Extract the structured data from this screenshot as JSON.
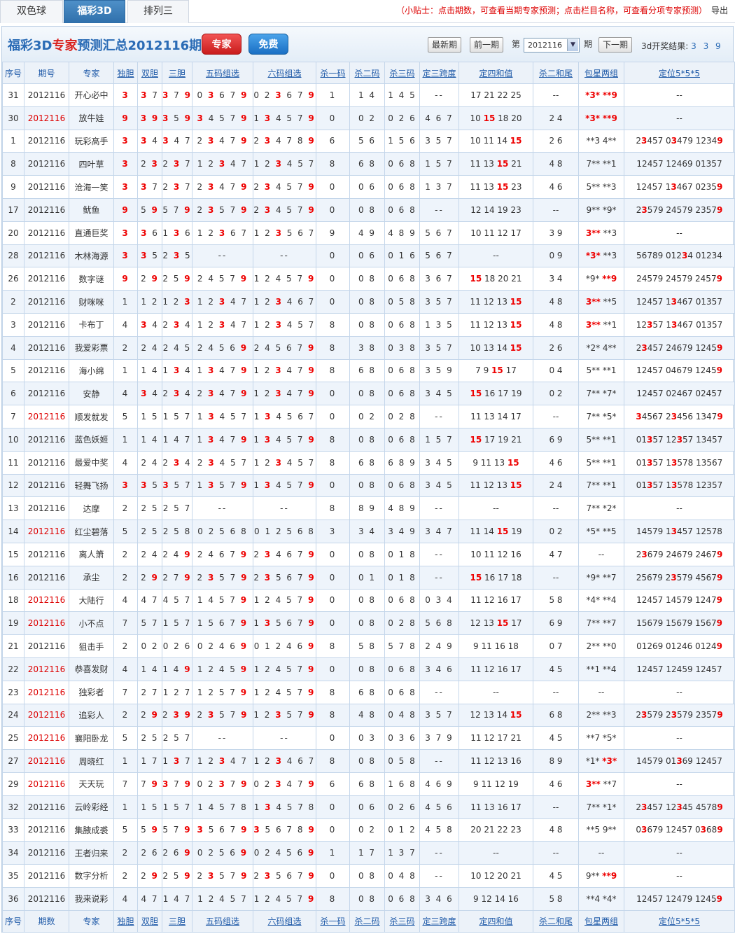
{
  "tabs": [
    "双色球",
    "福彩3D",
    "排列三"
  ],
  "active_tab": 1,
  "tip": "（小贴士：点击期数，可查看当期专家预测；点击栏目名称，可查看分项专家预测）",
  "export_label": "导出",
  "header": {
    "title_a": "福彩3D",
    "title_b": "专家",
    "title_c": "预测汇总2012116期",
    "btn_expert": "专家",
    "btn_free": "免费",
    "btn_latest": "最新期",
    "btn_prev": "前一期",
    "label_di": "第",
    "period_value": "2012116",
    "label_qi": "期",
    "btn_next": "下一期",
    "result_label": "3d开奖结果:",
    "result_value": "3 3 9"
  },
  "columns": [
    "序号",
    "期号",
    "专家",
    "独胆",
    "双胆",
    "三胆",
    "五码组选",
    "六码组选",
    "杀一码",
    "杀二码",
    "杀三码",
    "定三跨度",
    "定四和值",
    "杀二和尾",
    "包星两组",
    "定位5*5*5"
  ],
  "footer_columns": [
    "序号",
    "期数",
    "专家",
    "独胆",
    "双胆",
    "三胆",
    "五码组选",
    "六码组选",
    "杀一码",
    "杀二码",
    "杀三码",
    "定三跨度",
    "定四和值",
    "杀二和尾",
    "包星两组",
    "定位5*5*5"
  ],
  "colors": {
    "hit": "#e00000",
    "link": "#1f5aa8",
    "border": "#c4d6ea"
  },
  "rows": [
    [
      "31",
      "2012116",
      "开心必中",
      "[3]",
      "[3] 7",
      "[3] 7 [9]",
      "0 [3] 6 7 [9]",
      "0 2 [3] 6 7 [9]",
      "1",
      "1 4",
      "1 4 5",
      "--",
      "17 21 22 25",
      "--",
      "[*3*] [**9]",
      "--"
    ],
    [
      "30",
      "2012116",
      "放牛娃",
      "[9]",
      "[3] [9]",
      "[3] 5 [9]",
      "[3] 4 5 7 [9]",
      "1 [3] 4 5 7 [9]",
      "0",
      "0 2",
      "0 2 6",
      "4 6 7",
      "10 [15] 18 20",
      "2 4",
      "[*3*] [**9]",
      "--"
    ],
    [
      "1",
      "2012116",
      "玩彩高手",
      "[3]",
      "[3] 4",
      "[3] 4 7",
      "2 [3] 4 7 [9]",
      "2 [3] 4 7 8 [9]",
      "6",
      "5 6",
      "1 5 6",
      "3 5 7",
      "10 11 14 [15]",
      "2 6",
      "**3 4**",
      "2[3]457 0[3]479 1234[9]"
    ],
    [
      "8",
      "2012116",
      "四叶草",
      "[3]",
      "2 [3]",
      "2 [3] 7",
      "1 2 [3] 4 7",
      "1 2 [3] 4 5 7",
      "8",
      "6 8",
      "0 6 8",
      "1 5 7",
      "11 13 [15] 21",
      "4 8",
      "7** **1",
      "12457 12469 01357"
    ],
    [
      "9",
      "2012116",
      "沧海一笑",
      "[3]",
      "[3] 7",
      "2 [3] 7",
      "2 [3] 4 7 [9]",
      "2 [3] 4 5 7 [9]",
      "0",
      "0 6",
      "0 6 8",
      "1 3 7",
      "11 13 [15] 23",
      "4 6",
      "5** **3",
      "12457 1[3]467 0235[9]"
    ],
    [
      "17",
      "2012116",
      "鱿鱼",
      "[9]",
      "5 [9]",
      "5 7 [9]",
      "2 [3] 5 7 [9]",
      "2 [3] 4 5 7 [9]",
      "0",
      "0 8",
      "0 6 8",
      "--",
      "12 14 19 23",
      "--",
      "9** *9*",
      "2[3]579 24579 2357[9]"
    ],
    [
      "20",
      "2012116",
      "直通巨奖",
      "[3]",
      "[3] 6",
      "1 [3] 6",
      "1 2 [3] 6 7",
      "1 2 [3] 5 6 7",
      "9",
      "4 9",
      "4 8 9",
      "5 6 7",
      "10 11 12 17",
      "3 9",
      "[3**] **3",
      "--"
    ],
    [
      "28",
      "2012116",
      "木林海源",
      "[3]",
      "[3] 5",
      "2 [3] 5",
      "--",
      "--",
      "0",
      "0 6",
      "0 1 6",
      "5 6 7",
      "--",
      "0 9",
      "[*3*] **3",
      "56789 012[3]4 01234"
    ],
    [
      "26",
      "2012116",
      "数字谜",
      "[9]",
      "2 [9]",
      "2 5 [9]",
      "2 4 5 7 [9]",
      "1 2 4 5 7 [9]",
      "0",
      "0 8",
      "0 6 8",
      "3 6 7",
      "[15] 18 20 21",
      "3 4",
      "*9* [**9]",
      "24579 24579 2457[9]"
    ],
    [
      "2",
      "2012116",
      "财咪咪",
      "1",
      "1 2",
      "1 2 [3]",
      "1 2 [3] 4 7",
      "1 2 [3] 4 6 7",
      "0",
      "0 8",
      "0 5 8",
      "3 5 7",
      "11 12 13 [15]",
      "4 8",
      "[3**] **5",
      "12457 1[3]467 01357"
    ],
    [
      "3",
      "2012116",
      "卡布丁",
      "4",
      "[3] 4",
      "2 [3] 4",
      "1 2 [3] 4 7",
      "1 2 [3] 4 5 7",
      "8",
      "0 8",
      "0 6 8",
      "1 3 5",
      "11 12 13 [15]",
      "4 8",
      "[3**] **1",
      "12[3]57 1[3]467 01357"
    ],
    [
      "4",
      "2012116",
      "我爱彩票",
      "2",
      "2 4",
      "2 4 5",
      "2 4 5 6 [9]",
      "2 4 5 6 7 [9]",
      "8",
      "3 8",
      "0 3 8",
      "3 5 7",
      "10 13 14 [15]",
      "2 6",
      "*2* 4**",
      "2[3]457 24679 1245[9]"
    ],
    [
      "5",
      "2012116",
      "海小绵",
      "1",
      "1 4",
      "1 [3] 4",
      "1 [3] 4 7 [9]",
      "1 2 [3] 4 7 [9]",
      "8",
      "6 8",
      "0 6 8",
      "3 5 9",
      "7 9 [15] 17",
      "0 4",
      "5** **1",
      "12457 04679 1245[9]"
    ],
    [
      "6",
      "2012116",
      "安静",
      "4",
      "[3] 4",
      "2 [3] 4",
      "2 [3] 4 7 [9]",
      "1 2 [3] 4 7 [9]",
      "0",
      "0 8",
      "0 6 8",
      "3 4 5",
      "[15] 16 17 19",
      "0 2",
      "7** *7*",
      "12457 02467 02457"
    ],
    [
      "7",
      "2012116",
      "顺发就发",
      "5",
      "1 5",
      "1 5 7",
      "1 [3] 4 5 7",
      "1 [3] 4 5 6 7",
      "0",
      "0 2",
      "0 2 8",
      "--",
      "11 13 14 17",
      "--",
      "7** *5*",
      "[3]4567 2[3]456 1347[9]"
    ],
    [
      "10",
      "2012116",
      "蓝色妖姬",
      "1",
      "1 4",
      "1 4 7",
      "1 [3] 4 7 [9]",
      "1 [3] 4 5 7 [9]",
      "8",
      "0 8",
      "0 6 8",
      "1 5 7",
      "[15] 17 19 21",
      "6 9",
      "5** **1",
      "01[3]57 12[3]57 13457"
    ],
    [
      "11",
      "2012116",
      "最爱中奖",
      "4",
      "2 4",
      "2 [3] 4",
      "2 [3] 4 5 7",
      "1 2 [3] 4 5 7",
      "8",
      "6 8",
      "6 8 9",
      "3 4 5",
      "9 11 13 [15]",
      "4 6",
      "5** **1",
      "01[3]57 1[3]578 13567"
    ],
    [
      "12",
      "2012116",
      "轻舞飞扬",
      "[3]",
      "[3] 5",
      "[3] 5 7",
      "1 [3] 5 7 [9]",
      "1 [3] 4 5 7 [9]",
      "0",
      "0 8",
      "0 6 8",
      "3 4 5",
      "11 12 13 [15]",
      "2 4",
      "7** **1",
      "01[3]57 1[3]578 12357"
    ],
    [
      "13",
      "2012116",
      "达摩",
      "2",
      "2 5",
      "2 5 7",
      "--",
      "--",
      "8",
      "8 9",
      "4 8 9",
      "--",
      "--",
      "--",
      "7** *2*",
      "--"
    ],
    [
      "14",
      "2012116",
      "红尘碧落",
      "5",
      "2 5",
      "2 5 8",
      "0 2 5 6 8",
      "0 1 2 5 6 8",
      "3",
      "3 4",
      "3 4 9",
      "3 4 7",
      "11 14 [15] 19",
      "0 2",
      "*5* **5",
      "14579 1[3]457 12578"
    ],
    [
      "15",
      "2012116",
      "离人箫",
      "2",
      "2 4",
      "2 4 [9]",
      "2 4 6 7 [9]",
      "2 [3] 4 6 7 [9]",
      "0",
      "0 8",
      "0 1 8",
      "--",
      "10 11 12 16",
      "4 7",
      "--",
      "2[3]679 24679 2467[9]"
    ],
    [
      "16",
      "2012116",
      "承尘",
      "2",
      "2 [9]",
      "2 7 [9]",
      "2 [3] 5 7 [9]",
      "2 [3] 5 6 7 [9]",
      "0",
      "0 1",
      "0 1 8",
      "--",
      "[15] 16 17 18",
      "--",
      "*9* **7",
      "25679 2[3]579 4567[9]"
    ],
    [
      "18",
      "2012116",
      "大陆行",
      "4",
      "4 7",
      "4 5 7",
      "1 4 5 7 [9]",
      "1 2 4 5 7 [9]",
      "0",
      "0 8",
      "0 6 8",
      "0 3 4",
      "11 12 16 17",
      "5 8",
      "*4* **4",
      "12457 14579 1247[9]"
    ],
    [
      "19",
      "2012116",
      "小不点",
      "7",
      "5 7",
      "1 5 7",
      "1 5 6 7 [9]",
      "1 [3] 5 6 7 [9]",
      "0",
      "0 8",
      "0 2 8",
      "5 6 8",
      "12 13 [15] 17",
      "6 9",
      "7** **7",
      "15679 15679 1567[9]"
    ],
    [
      "21",
      "2012116",
      "狙击手",
      "2",
      "0 2",
      "0 2 6",
      "0 2 4 6 [9]",
      "0 1 2 4 6 [9]",
      "8",
      "5 8",
      "5 7 8",
      "2 4 9",
      "9 11 16 18",
      "0 7",
      "2** **0",
      "01269 01246 0124[9]"
    ],
    [
      "22",
      "2012116",
      "恭喜发财",
      "4",
      "1 4",
      "1 4 [9]",
      "1 2 4 5 [9]",
      "1 2 4 5 7 [9]",
      "0",
      "0 8",
      "0 6 8",
      "3 4 6",
      "11 12 16 17",
      "4 5",
      "**1 **4",
      "12457 12459 12457"
    ],
    [
      "23",
      "2012116",
      "独彩者",
      "7",
      "2 7",
      "1 2 7",
      "1 2 5 7 [9]",
      "1 2 4 5 7 [9]",
      "8",
      "6 8",
      "0 6 8",
      "--",
      "--",
      "--",
      "--",
      "--"
    ],
    [
      "24",
      "2012116",
      "追彩人",
      "2",
      "2 [9]",
      "2 [3] [9]",
      "2 [3] 5 7 [9]",
      "1 2 [3] 5 7 [9]",
      "8",
      "4 8",
      "0 4 8",
      "3 5 7",
      "12 13 14 [15]",
      "6 8",
      "2** **3",
      "2[3]579 2[3]579 2357[9]"
    ],
    [
      "25",
      "2012116",
      "襄阳卧龙",
      "5",
      "2 5",
      "2 5 7",
      "--",
      "--",
      "0",
      "0 3",
      "0 3 6",
      "3 7 9",
      "11 12 17 21",
      "4 5",
      "**7 *5*",
      "--"
    ],
    [
      "27",
      "2012116",
      "周晓红",
      "1",
      "1 7",
      "1 [3] 7",
      "1 2 [3] 4 7",
      "1 2 [3] 4 6 7",
      "8",
      "0 8",
      "0 5 8",
      "--",
      "11 12 13 16",
      "8 9",
      "*1* [*3*]",
      "14579 01[3]69 12457"
    ],
    [
      "29",
      "2012116",
      "天天玩",
      "7",
      "7 [9]",
      "[3] 7 [9]",
      "0 2 [3] 7 [9]",
      "0 2 [3] 4 7 [9]",
      "6",
      "6 8",
      "1 6 8",
      "4 6 9",
      "9 11 12 19",
      "4 6",
      "[3**] **7",
      "--"
    ],
    [
      "32",
      "2012116",
      "云岭彩经",
      "1",
      "1 5",
      "1 5 7",
      "1 4 5 7 8",
      "1 [3] 4 5 7 8",
      "0",
      "0 6",
      "0 2 6",
      "4 5 6",
      "11 13 16 17",
      "--",
      "7** *1*",
      "2[3]457 12[3]45 4578[9]"
    ],
    [
      "33",
      "2012116",
      "集腋成裘",
      "5",
      "5 [9]",
      "5 7 [9]",
      "[3] 5 6 7 [9]",
      "[3] 5 6 7 8 [9]",
      "0",
      "0 2",
      "0 1 2",
      "4 5 8",
      "20 21 22 23",
      "4 8",
      "**5 9**",
      "0[3]679 12457 0[3]68[9]"
    ],
    [
      "34",
      "2012116",
      "王者归来",
      "2",
      "2 6",
      "2 6 [9]",
      "0 2 5 6 [9]",
      "0 2 4 5 6 [9]",
      "1",
      "1 7",
      "1 3 7",
      "--",
      "--",
      "--",
      "--",
      "--"
    ],
    [
      "35",
      "2012116",
      "数字分析",
      "2",
      "2 [9]",
      "2 5 [9]",
      "2 [3] 5 7 [9]",
      "2 [3] 5 6 7 [9]",
      "0",
      "0 8",
      "0 4 8",
      "--",
      "10 12 20 21",
      "4 5",
      "9** [**9]",
      "--"
    ],
    [
      "36",
      "2012116",
      "我来说彩",
      "4",
      "4 7",
      "1 4 7",
      "1 2 4 5 7",
      "1 2 4 5 7 [9]",
      "8",
      "0 8",
      "0 6 8",
      "3 4 6",
      "9 12 14 16",
      "5 8",
      "**4 *4*",
      "12457 12479 1245[9]"
    ]
  ],
  "red_period_rows": [
    "30",
    "7",
    "14",
    "18",
    "19",
    "22",
    "23",
    "24",
    "25",
    "27",
    "29"
  ],
  "col_widths": [
    31,
    64,
    64,
    34,
    35,
    43,
    87,
    90,
    48,
    50,
    50,
    56,
    106,
    65,
    65,
    158
  ]
}
